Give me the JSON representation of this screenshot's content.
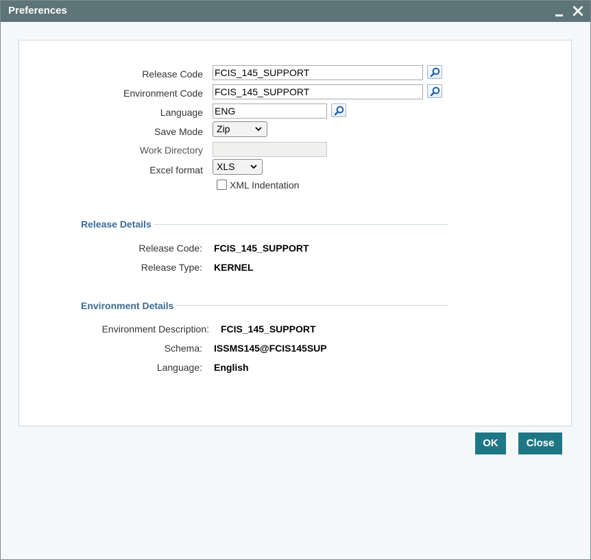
{
  "window": {
    "title": "Preferences"
  },
  "form": {
    "release_code": {
      "label": "Release Code",
      "value": "FCIS_145_SUPPORT"
    },
    "environment_code": {
      "label": "Environment Code",
      "value": "FCIS_145_SUPPORT"
    },
    "language": {
      "label": "Language",
      "value": "ENG"
    },
    "save_mode": {
      "label": "Save Mode",
      "value": "Zip"
    },
    "work_directory": {
      "label": "Work Directory",
      "value": ""
    },
    "excel_format": {
      "label": "Excel format",
      "value": "XLS"
    },
    "xml_indentation": {
      "label": "XML Indentation",
      "checked": false
    }
  },
  "release_details": {
    "title": "Release Details",
    "release_code_label": "Release Code:",
    "release_code_value": "FCIS_145_SUPPORT",
    "release_type_label": "Release Type:",
    "release_type_value": "KERNEL"
  },
  "environment_details": {
    "title": "Environment Details",
    "description_label": "Environment Description:",
    "description_value": "FCIS_145_SUPPORT",
    "schema_label": "Schema:",
    "schema_value": "ISSMS145@FCIS145SUP",
    "language_label": "Language:",
    "language_value": "English"
  },
  "buttons": {
    "ok": "OK",
    "close": "Close"
  },
  "icons": {
    "minimize": "minimize-icon",
    "close": "close-icon",
    "lookup": "search-icon",
    "dropdown": "chevron-down-icon"
  },
  "colors": {
    "titlebar": "#5d7479",
    "accent_button": "#1e7785",
    "section_title": "#3a6b94"
  }
}
